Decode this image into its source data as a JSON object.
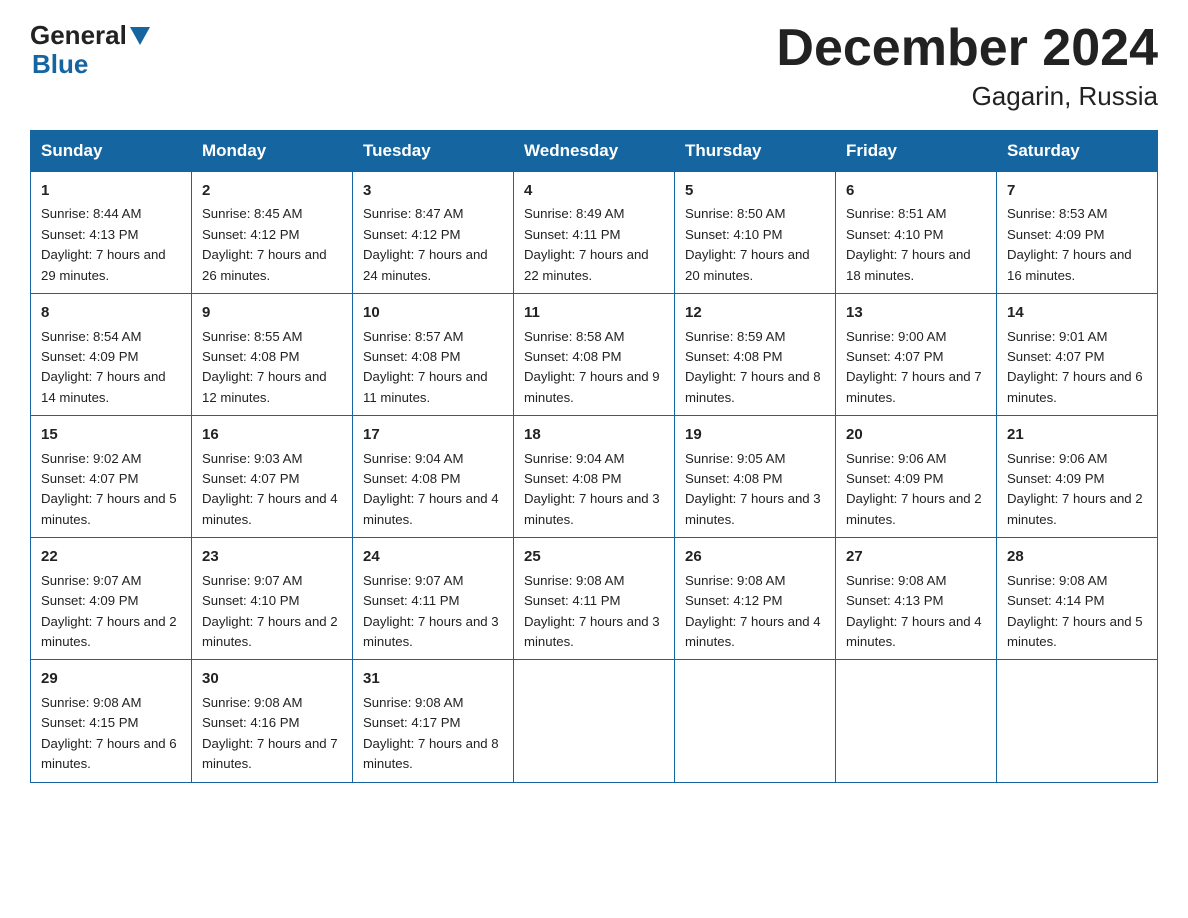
{
  "header": {
    "logo_general": "General",
    "logo_blue": "Blue",
    "title": "December 2024",
    "subtitle": "Gagarin, Russia"
  },
  "weekdays": [
    "Sunday",
    "Monday",
    "Tuesday",
    "Wednesday",
    "Thursday",
    "Friday",
    "Saturday"
  ],
  "weeks": [
    [
      {
        "day": "1",
        "sunrise": "8:44 AM",
        "sunset": "4:13 PM",
        "daylight": "7 hours and 29 minutes."
      },
      {
        "day": "2",
        "sunrise": "8:45 AM",
        "sunset": "4:12 PM",
        "daylight": "7 hours and 26 minutes."
      },
      {
        "day": "3",
        "sunrise": "8:47 AM",
        "sunset": "4:12 PM",
        "daylight": "7 hours and 24 minutes."
      },
      {
        "day": "4",
        "sunrise": "8:49 AM",
        "sunset": "4:11 PM",
        "daylight": "7 hours and 22 minutes."
      },
      {
        "day": "5",
        "sunrise": "8:50 AM",
        "sunset": "4:10 PM",
        "daylight": "7 hours and 20 minutes."
      },
      {
        "day": "6",
        "sunrise": "8:51 AM",
        "sunset": "4:10 PM",
        "daylight": "7 hours and 18 minutes."
      },
      {
        "day": "7",
        "sunrise": "8:53 AM",
        "sunset": "4:09 PM",
        "daylight": "7 hours and 16 minutes."
      }
    ],
    [
      {
        "day": "8",
        "sunrise": "8:54 AM",
        "sunset": "4:09 PM",
        "daylight": "7 hours and 14 minutes."
      },
      {
        "day": "9",
        "sunrise": "8:55 AM",
        "sunset": "4:08 PM",
        "daylight": "7 hours and 12 minutes."
      },
      {
        "day": "10",
        "sunrise": "8:57 AM",
        "sunset": "4:08 PM",
        "daylight": "7 hours and 11 minutes."
      },
      {
        "day": "11",
        "sunrise": "8:58 AM",
        "sunset": "4:08 PM",
        "daylight": "7 hours and 9 minutes."
      },
      {
        "day": "12",
        "sunrise": "8:59 AM",
        "sunset": "4:08 PM",
        "daylight": "7 hours and 8 minutes."
      },
      {
        "day": "13",
        "sunrise": "9:00 AM",
        "sunset": "4:07 PM",
        "daylight": "7 hours and 7 minutes."
      },
      {
        "day": "14",
        "sunrise": "9:01 AM",
        "sunset": "4:07 PM",
        "daylight": "7 hours and 6 minutes."
      }
    ],
    [
      {
        "day": "15",
        "sunrise": "9:02 AM",
        "sunset": "4:07 PM",
        "daylight": "7 hours and 5 minutes."
      },
      {
        "day": "16",
        "sunrise": "9:03 AM",
        "sunset": "4:07 PM",
        "daylight": "7 hours and 4 minutes."
      },
      {
        "day": "17",
        "sunrise": "9:04 AM",
        "sunset": "4:08 PM",
        "daylight": "7 hours and 4 minutes."
      },
      {
        "day": "18",
        "sunrise": "9:04 AM",
        "sunset": "4:08 PM",
        "daylight": "7 hours and 3 minutes."
      },
      {
        "day": "19",
        "sunrise": "9:05 AM",
        "sunset": "4:08 PM",
        "daylight": "7 hours and 3 minutes."
      },
      {
        "day": "20",
        "sunrise": "9:06 AM",
        "sunset": "4:09 PM",
        "daylight": "7 hours and 2 minutes."
      },
      {
        "day": "21",
        "sunrise": "9:06 AM",
        "sunset": "4:09 PM",
        "daylight": "7 hours and 2 minutes."
      }
    ],
    [
      {
        "day": "22",
        "sunrise": "9:07 AM",
        "sunset": "4:09 PM",
        "daylight": "7 hours and 2 minutes."
      },
      {
        "day": "23",
        "sunrise": "9:07 AM",
        "sunset": "4:10 PM",
        "daylight": "7 hours and 2 minutes."
      },
      {
        "day": "24",
        "sunrise": "9:07 AM",
        "sunset": "4:11 PM",
        "daylight": "7 hours and 3 minutes."
      },
      {
        "day": "25",
        "sunrise": "9:08 AM",
        "sunset": "4:11 PM",
        "daylight": "7 hours and 3 minutes."
      },
      {
        "day": "26",
        "sunrise": "9:08 AM",
        "sunset": "4:12 PM",
        "daylight": "7 hours and 4 minutes."
      },
      {
        "day": "27",
        "sunrise": "9:08 AM",
        "sunset": "4:13 PM",
        "daylight": "7 hours and 4 minutes."
      },
      {
        "day": "28",
        "sunrise": "9:08 AM",
        "sunset": "4:14 PM",
        "daylight": "7 hours and 5 minutes."
      }
    ],
    [
      {
        "day": "29",
        "sunrise": "9:08 AM",
        "sunset": "4:15 PM",
        "daylight": "7 hours and 6 minutes."
      },
      {
        "day": "30",
        "sunrise": "9:08 AM",
        "sunset": "4:16 PM",
        "daylight": "7 hours and 7 minutes."
      },
      {
        "day": "31",
        "sunrise": "9:08 AM",
        "sunset": "4:17 PM",
        "daylight": "7 hours and 8 minutes."
      },
      null,
      null,
      null,
      null
    ]
  ]
}
